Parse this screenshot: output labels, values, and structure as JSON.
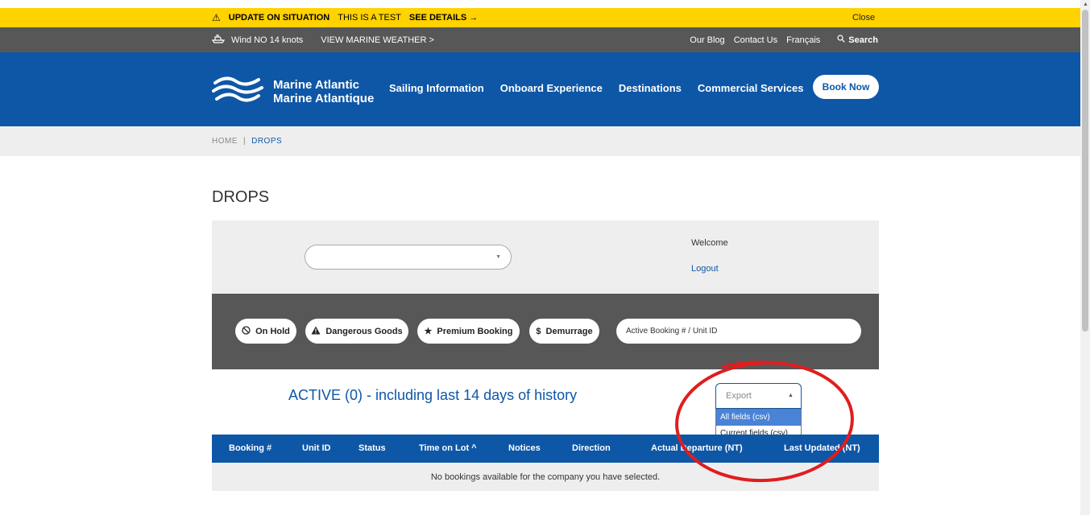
{
  "alert": {
    "title": "UPDATE ON SITUATION",
    "message": "THIS IS A TEST",
    "details_link": "SEE DETAILS →",
    "close": "Close"
  },
  "utility_bar": {
    "wind": "Wind NO 14 knots",
    "weather_link": "VIEW MARINE WEATHER >",
    "blog": "Our Blog",
    "contact": "Contact Us",
    "language": "Français",
    "search": "Search"
  },
  "header": {
    "logo_line1": "Marine Atlantic",
    "logo_line2": "Marine Atlantique",
    "nav": [
      "Sailing Information",
      "Onboard Experience",
      "Destinations",
      "Commercial Services"
    ],
    "book_now": "Book Now"
  },
  "breadcrumb": {
    "home": "HOME",
    "separator": "|",
    "current": "DROPS"
  },
  "page_title": "DROPS",
  "account": {
    "company_value": "",
    "welcome": "Welcome",
    "logout": "Logout"
  },
  "filters": {
    "on_hold": "On Hold",
    "dangerous_goods": "Dangerous Goods",
    "premium_booking": "Premium Booking",
    "demurrage": "Demurrage",
    "search_placeholder": "Active Booking # / Unit ID"
  },
  "active_heading": "ACTIVE (0) - including last 14 days of history",
  "export": {
    "label": "Export",
    "options": [
      "All fields (csv)",
      "Current fields (csv)"
    ],
    "highlighted": "All fields (csv)"
  },
  "table": {
    "columns": [
      "Booking #",
      "Unit ID",
      "Status",
      "Time on Lot ^",
      "Notices",
      "Direction",
      "Actual Departure (NT)",
      "Last Updated (NT)"
    ],
    "empty_message": "No bookings available for the company you have selected."
  },
  "colors": {
    "alert_yellow": "#ffd200",
    "utility_gray": "#575757",
    "brand_blue": "#0e57a7",
    "panel_gray": "#eeeeee",
    "annotation_red": "#e01d1d"
  }
}
